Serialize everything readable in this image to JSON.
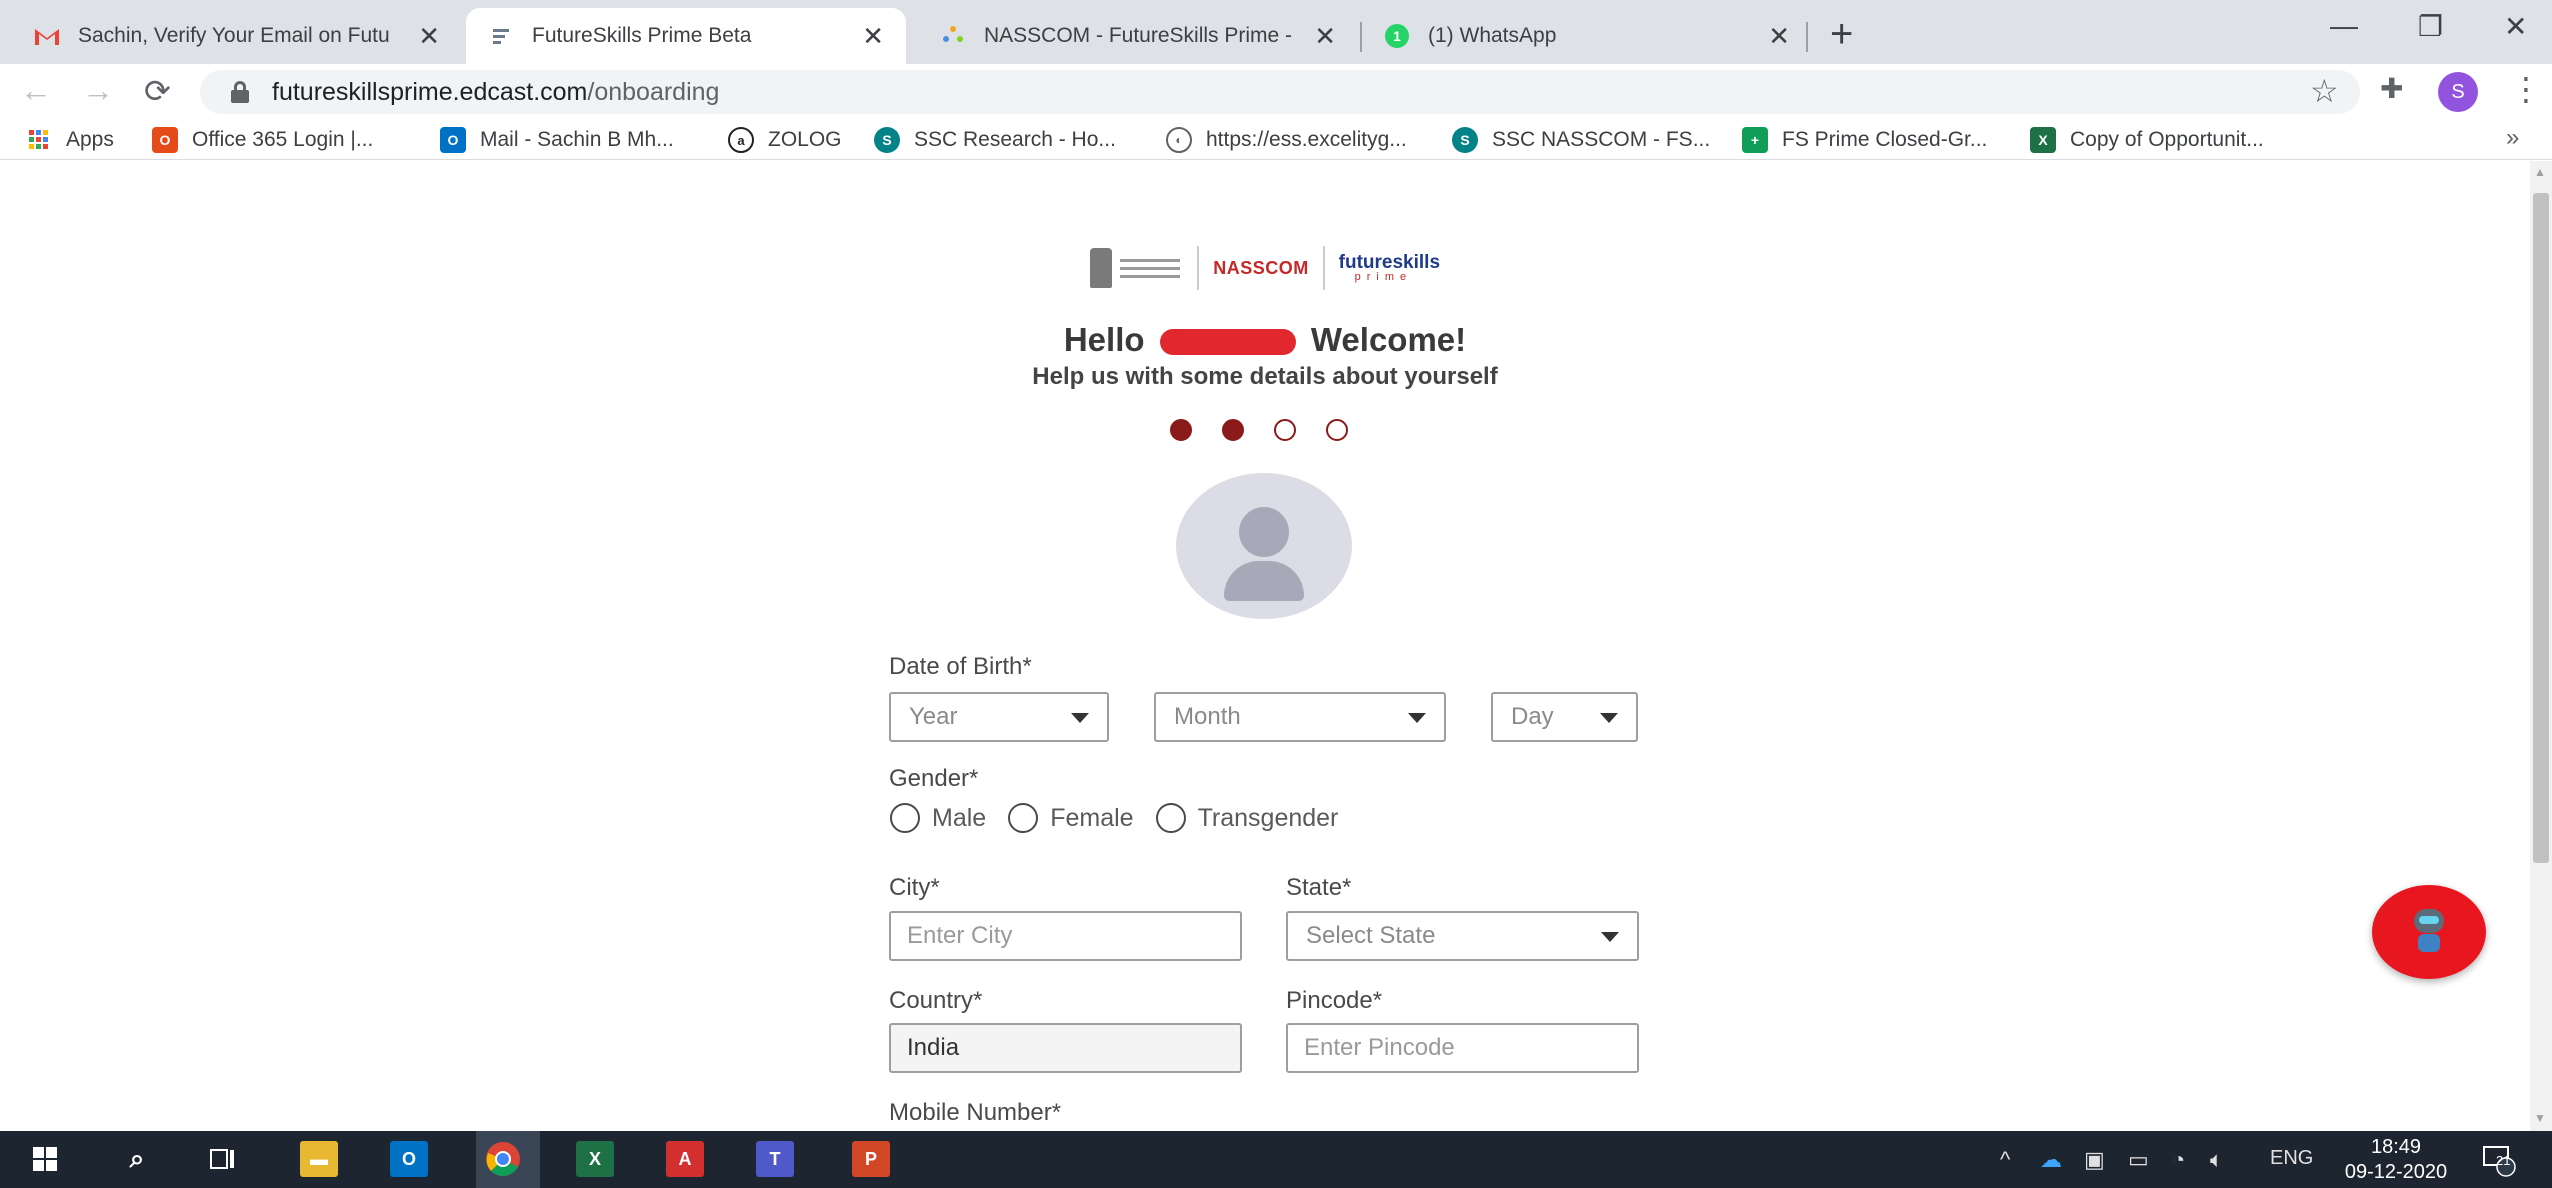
{
  "browser": {
    "tabs": [
      {
        "title": "Sachin, Verify Your Email on Futu",
        "icon": "gmail-icon",
        "active": false
      },
      {
        "title": "FutureSkills Prime Beta",
        "icon": "futureskills-icon",
        "active": true
      },
      {
        "title": "NASSCOM - FutureSkills Prime - ",
        "icon": "nasscom-icon",
        "active": false
      },
      {
        "title": "(1) WhatsApp",
        "icon": "whatsapp-icon",
        "active": false,
        "badge": "1"
      }
    ],
    "url_domain": "futureskillsprime.edcast.com",
    "url_path": "/onboarding",
    "profile_initial": "S"
  },
  "bookmarks": [
    {
      "label": "Apps",
      "icon": "apps-grid-icon",
      "color": "#1a73e8"
    },
    {
      "label": "Office 365 Login |...",
      "icon": "office-icon",
      "color": "#e64a19"
    },
    {
      "label": "Mail - Sachin B Mh...",
      "icon": "outlook-icon",
      "color": "#0072c6"
    },
    {
      "label": "ZOLOG",
      "icon": "zolog-icon",
      "color": "#222222"
    },
    {
      "label": "SSC Research - Ho...",
      "icon": "sharepoint-icon",
      "color": "#038387"
    },
    {
      "label": "https://ess.excelityg...",
      "icon": "globe-icon",
      "color": "#5f6368"
    },
    {
      "label": "SSC NASSCOM - FS...",
      "icon": "sharepoint-icon",
      "color": "#038387"
    },
    {
      "label": "FS Prime Closed-Gr...",
      "icon": "sheets-icon",
      "color": "#0f9d58"
    },
    {
      "label": "Copy of Opportunit...",
      "icon": "excel-icon",
      "color": "#1e7145"
    }
  ],
  "onboarding": {
    "logo_nasscom": "NASSCOM",
    "logo_fs_top": "futureskills",
    "logo_fs_bottom": "prime",
    "greeting_prefix": "Hello",
    "greeting_suffix": "Welcome!",
    "subtitle": "Help us with some details about yourself",
    "steps_total": 4,
    "steps_completed": 2,
    "dob_label": "Date of Birth*",
    "year_placeholder": "Year",
    "month_placeholder": "Month",
    "day_placeholder": "Day",
    "gender_label": "Gender*",
    "gender_options": [
      "Male",
      "Female",
      "Transgender"
    ],
    "city_label": "City*",
    "city_placeholder": "Enter City",
    "state_label": "State*",
    "state_placeholder": "Select State",
    "country_label": "Country*",
    "country_value": "India",
    "pincode_label": "Pincode*",
    "pincode_placeholder": "Enter Pincode",
    "mobile_label": "Mobile Number*"
  },
  "taskbar": {
    "language": "ENG",
    "time": "18:49",
    "date": "09-12-2020",
    "notification_count": "21"
  }
}
